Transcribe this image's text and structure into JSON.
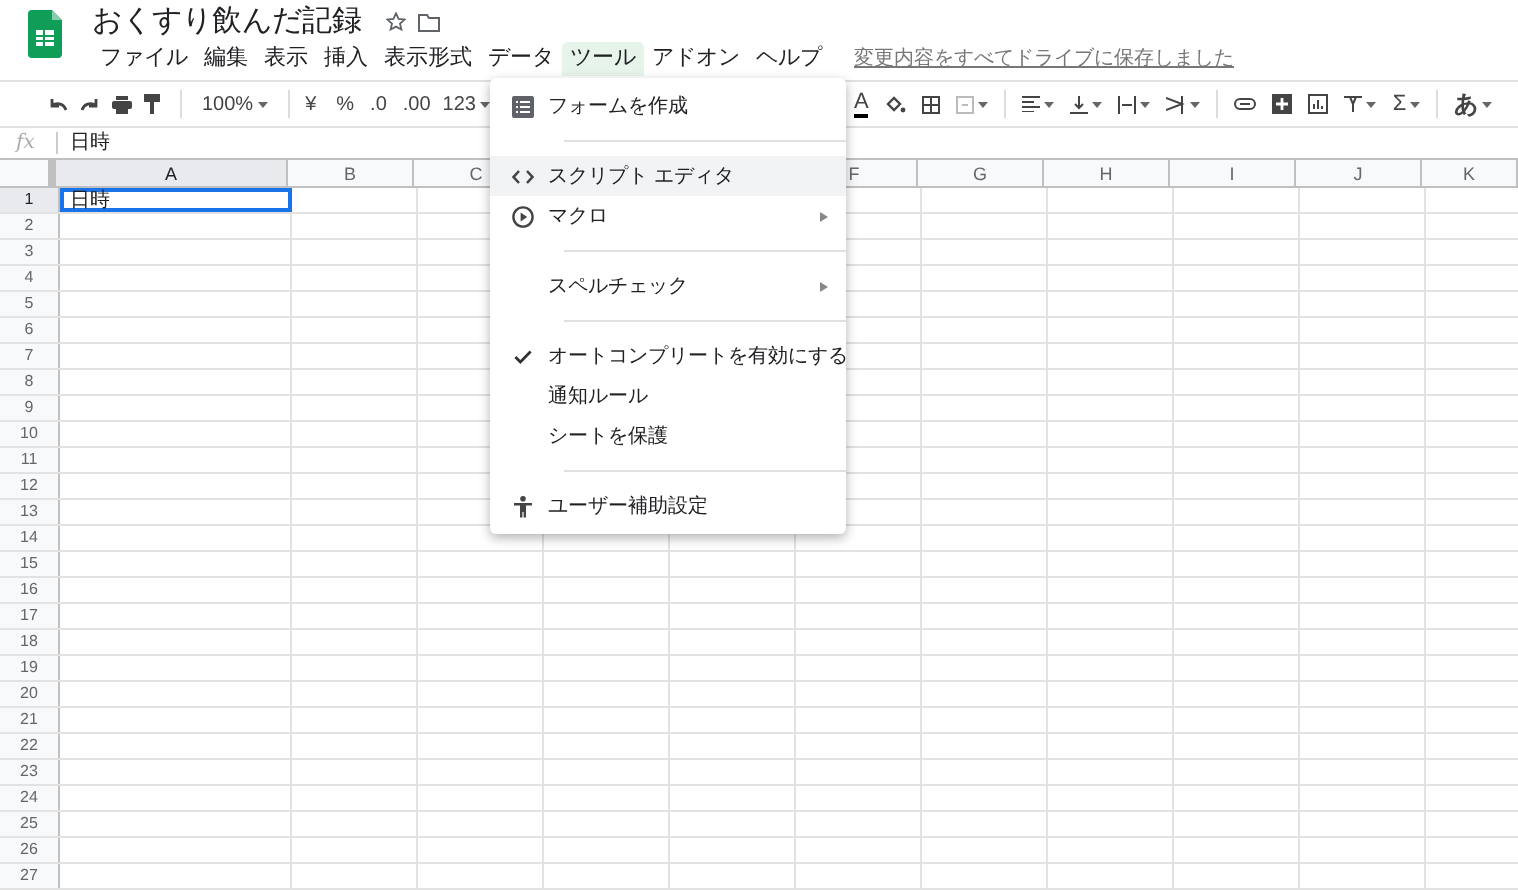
{
  "document": {
    "title": "おくすり飲んだ記録"
  },
  "menu_bar": [
    {
      "label": "ファイル",
      "selected": false
    },
    {
      "label": "編集",
      "selected": false
    },
    {
      "label": "表示",
      "selected": false
    },
    {
      "label": "挿入",
      "selected": false
    },
    {
      "label": "表示形式",
      "selected": false
    },
    {
      "label": "データ",
      "selected": false
    },
    {
      "label": "ツール",
      "selected": true
    },
    {
      "label": "アドオン",
      "selected": false
    },
    {
      "label": "ヘルプ",
      "selected": false
    }
  ],
  "save_status": "変更内容をすべてドライブに保存しました",
  "toolbar": {
    "zoom": "100%",
    "currency": "¥",
    "percent": "%",
    "decrease_decimal": ".0",
    "increase_decimal": ".00",
    "more_formats": "123",
    "text_color": "A",
    "functions": "Σ",
    "input_tools": "あ"
  },
  "formula_bar": {
    "label": "fx",
    "value": "日時"
  },
  "columns": [
    {
      "label": "A",
      "selected": true
    },
    {
      "label": "B",
      "selected": false
    },
    {
      "label": "C",
      "selected": false
    },
    {
      "label": "F",
      "selected": false
    },
    {
      "label": "G",
      "selected": false
    },
    {
      "label": "H",
      "selected": false
    },
    {
      "label": "I",
      "selected": false
    },
    {
      "label": "J",
      "selected": false
    },
    {
      "label": "K",
      "selected": false
    }
  ],
  "rows": [
    {
      "label": "1",
      "selected": true
    },
    {
      "label": "2",
      "selected": false
    },
    {
      "label": "3",
      "selected": false
    },
    {
      "label": "4",
      "selected": false
    },
    {
      "label": "5",
      "selected": false
    },
    {
      "label": "6",
      "selected": false
    },
    {
      "label": "7",
      "selected": false
    },
    {
      "label": "8",
      "selected": false
    },
    {
      "label": "9",
      "selected": false
    },
    {
      "label": "10",
      "selected": false
    },
    {
      "label": "11",
      "selected": false
    },
    {
      "label": "12",
      "selected": false
    },
    {
      "label": "13",
      "selected": false
    },
    {
      "label": "14",
      "selected": false
    },
    {
      "label": "15",
      "selected": false
    },
    {
      "label": "16",
      "selected": false
    },
    {
      "label": "17",
      "selected": false
    },
    {
      "label": "18",
      "selected": false
    },
    {
      "label": "19",
      "selected": false
    },
    {
      "label": "20",
      "selected": false
    },
    {
      "label": "21",
      "selected": false
    },
    {
      "label": "22",
      "selected": false
    },
    {
      "label": "23",
      "selected": false
    },
    {
      "label": "24",
      "selected": false
    },
    {
      "label": "25",
      "selected": false
    },
    {
      "label": "26",
      "selected": false
    },
    {
      "label": "27",
      "selected": false
    }
  ],
  "cell_a1": {
    "value": "日時",
    "selected": true
  },
  "tools_menu": [
    {
      "kind": "item",
      "label": "フォームを作成",
      "highlighted": false,
      "checked": false,
      "submenu": false
    },
    {
      "kind": "divider"
    },
    {
      "kind": "item",
      "label": "スクリプト エディタ",
      "highlighted": true,
      "checked": false,
      "submenu": false
    },
    {
      "kind": "item",
      "label": "マクロ",
      "highlighted": false,
      "checked": false,
      "submenu": true
    },
    {
      "kind": "divider"
    },
    {
      "kind": "item",
      "label": "スペルチェック",
      "highlighted": false,
      "checked": false,
      "submenu": true
    },
    {
      "kind": "divider"
    },
    {
      "kind": "item",
      "label": "オートコンプリートを有効にする",
      "highlighted": false,
      "checked": true,
      "submenu": false
    },
    {
      "kind": "item",
      "label": "通知ルール",
      "highlighted": false,
      "checked": false,
      "submenu": false
    },
    {
      "kind": "item",
      "label": "シートを保護",
      "highlighted": false,
      "checked": false,
      "submenu": false
    },
    {
      "kind": "divider"
    },
    {
      "kind": "item",
      "label": "ユーザー補助設定",
      "highlighted": false,
      "checked": false,
      "submenu": false
    }
  ]
}
